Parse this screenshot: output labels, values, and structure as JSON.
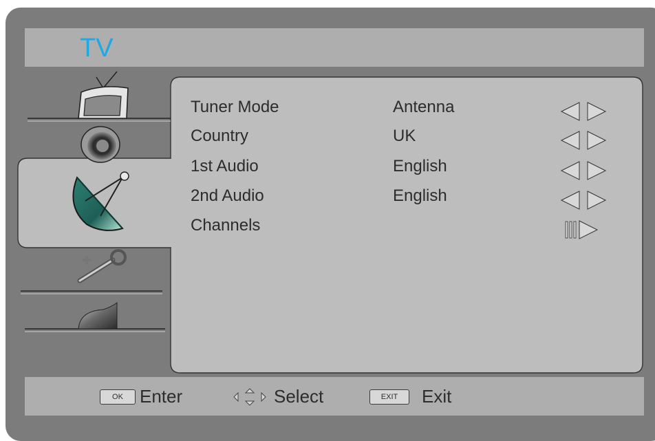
{
  "header": {
    "title": "TV"
  },
  "sidebar": {
    "items": [
      {
        "icon": "tv-icon",
        "selected": false
      },
      {
        "icon": "speaker-icon",
        "selected": false
      },
      {
        "icon": "satellite-dish-icon",
        "selected": true
      },
      {
        "icon": "wrench-icon",
        "selected": false
      },
      {
        "icon": "lock-icon",
        "selected": false
      }
    ]
  },
  "settings": {
    "rows": [
      {
        "label": "Tuner Mode",
        "value": "Antenna",
        "control": "left-right-arrows"
      },
      {
        "label": "Country",
        "value": "UK",
        "control": "left-right-arrows"
      },
      {
        "label": "1st Audio",
        "value": "English",
        "control": "left-right-arrows"
      },
      {
        "label": "2nd Audio",
        "value": "English",
        "control": "left-right-arrows"
      },
      {
        "label": "Channels",
        "value": "",
        "control": "enter-arrow"
      }
    ]
  },
  "footer": {
    "ok_key": "OK",
    "enter_label": "Enter",
    "select_label": "Select",
    "exit_key": "EXIT",
    "exit_label": "Exit"
  },
  "colors": {
    "frame": "#7c7c7c",
    "bar": "#aeaeae",
    "panel": "#bdbdbd",
    "title": "#1da8e6",
    "text": "#2c2c2c"
  }
}
